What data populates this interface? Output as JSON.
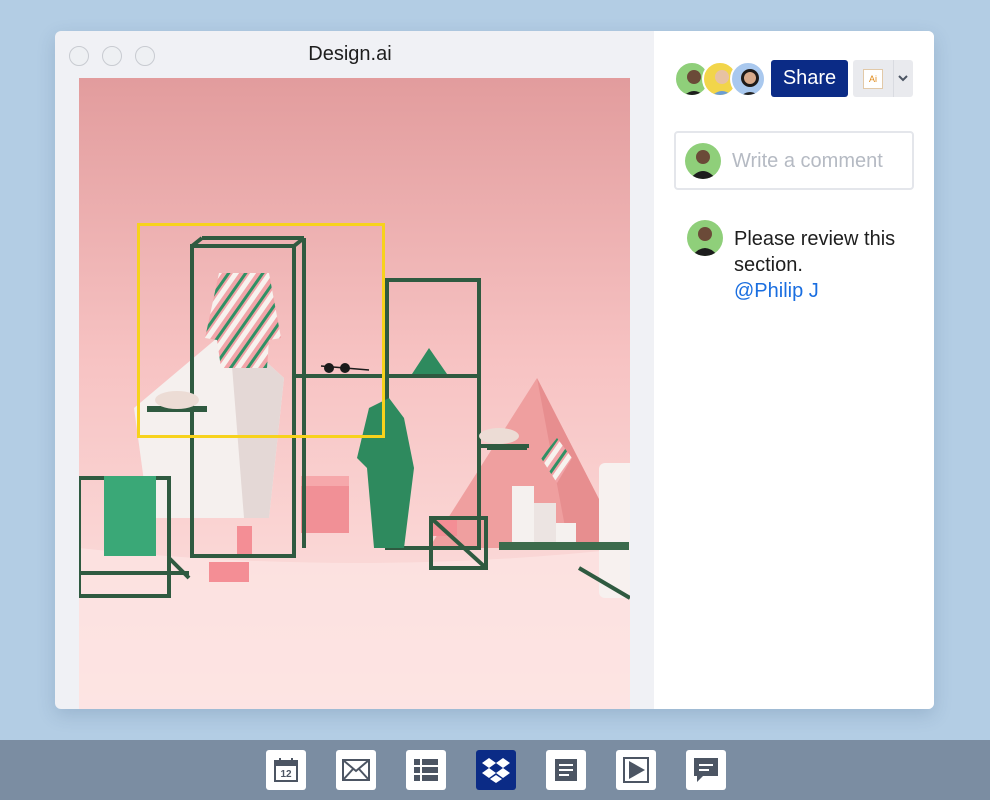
{
  "window": {
    "title": "Design.ai",
    "controls": [
      "close",
      "minimize",
      "maximize"
    ]
  },
  "artwork": {
    "description_icon": "fashion-display-illustration",
    "selection_color": "#f7d21c"
  },
  "panel": {
    "collaborators": [
      {
        "name": "collaborator-1",
        "icon": "avatar"
      },
      {
        "name": "collaborator-2",
        "icon": "avatar"
      },
      {
        "name": "collaborator-3",
        "icon": "avatar"
      }
    ],
    "share_label": "Share",
    "file_type_badge": "Ai",
    "comment_placeholder": "Write a comment",
    "comments": [
      {
        "text": "Please review this section.",
        "mention": "@Philip J"
      }
    ]
  },
  "dock": {
    "items": [
      {
        "name": "calendar",
        "icon": "calendar-icon",
        "label": "12",
        "active": false
      },
      {
        "name": "mail",
        "icon": "mail-icon",
        "active": false
      },
      {
        "name": "list",
        "icon": "list-icon",
        "active": false
      },
      {
        "name": "dropbox",
        "icon": "dropbox-icon",
        "active": true
      },
      {
        "name": "document",
        "icon": "document-icon",
        "active": false
      },
      {
        "name": "video",
        "icon": "play-icon",
        "active": false
      },
      {
        "name": "messages",
        "icon": "chat-icon",
        "active": false
      }
    ]
  },
  "colors": {
    "background": "#b3cde4",
    "accent": "#0b2b86",
    "mention": "#1a6ee0",
    "dock": "#7b8da2"
  }
}
